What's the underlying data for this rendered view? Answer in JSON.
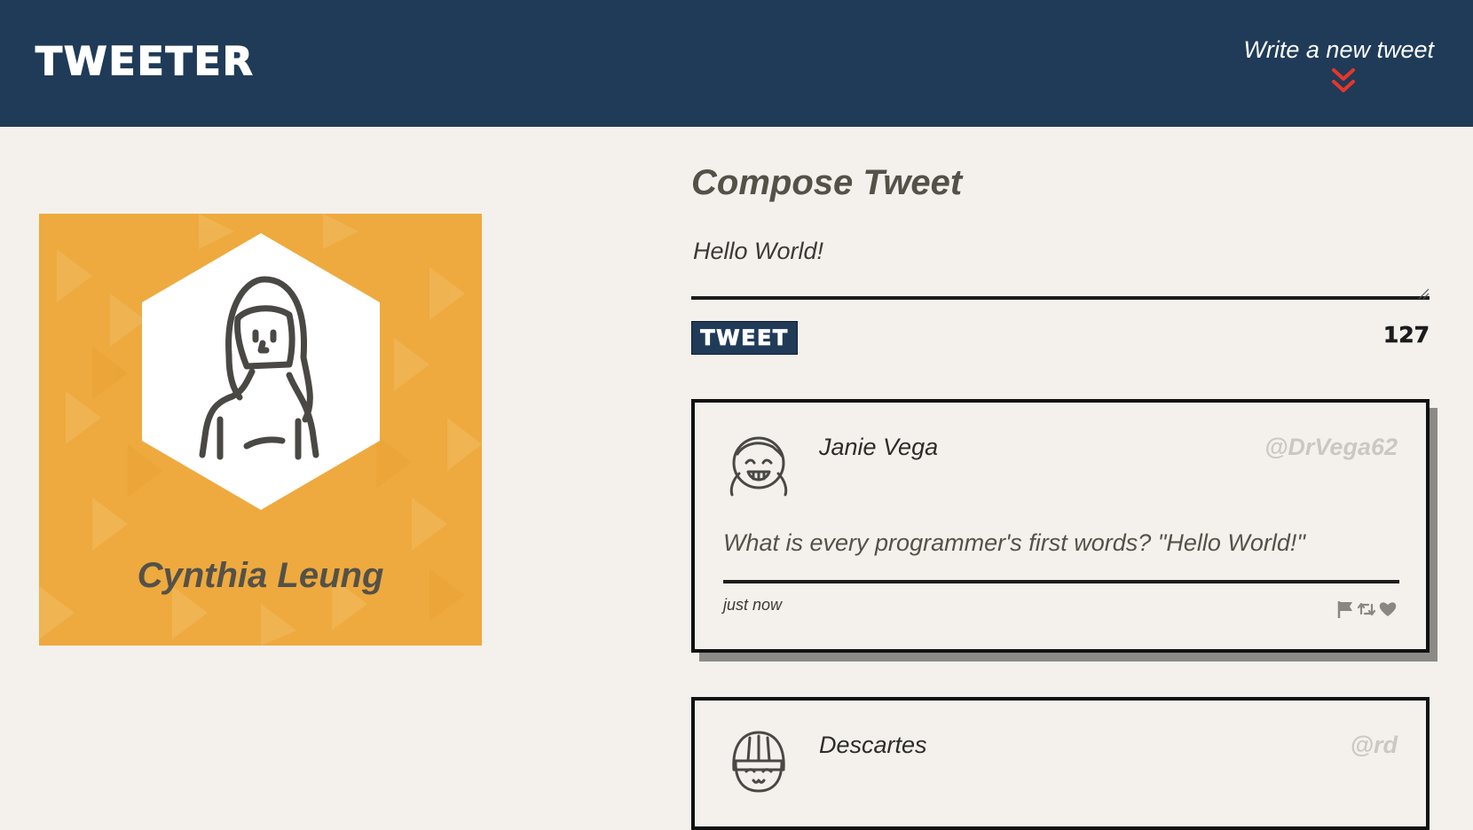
{
  "nav": {
    "brand": "TWEETER",
    "compose_toggle_label": "Write a new tweet",
    "chevron_icon": "double-chevron-down-icon",
    "chevron_color": "#e8362a"
  },
  "profile": {
    "name": "Cynthia Leung",
    "avatar_icon": "woman-avatar-icon",
    "background_color": "#eeaa3e"
  },
  "compose": {
    "title": "Compose Tweet",
    "input_value": "Hello World!",
    "button_label": "TWEET",
    "char_counter": "127"
  },
  "tweets": [
    {
      "name": "Janie Vega",
      "handle": "@DrVega62",
      "content": "What is every programmer's first words? \"Hello World!\"",
      "time": "just now",
      "avatar_icon": "girl-pigtails-avatar-icon",
      "actions": [
        "flag-icon",
        "retweet-icon",
        "heart-icon"
      ]
    },
    {
      "name": "Descartes",
      "handle": "@rd",
      "avatar_icon": "bob-hair-avatar-icon"
    }
  ],
  "colors": {
    "nav_bg": "#1f3b58",
    "page_bg": "#f4f1ec",
    "text": "#545149",
    "handle": "#cbc8c3"
  }
}
